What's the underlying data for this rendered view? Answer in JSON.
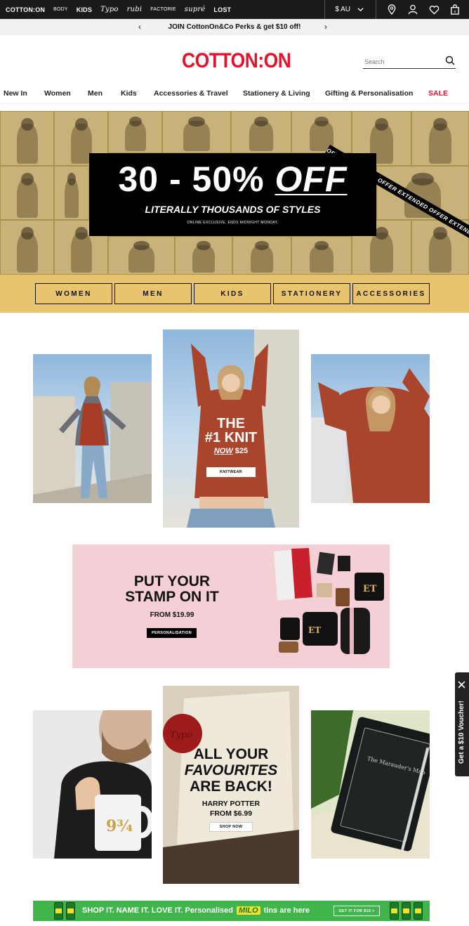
{
  "brandbar": {
    "brands": [
      "COTTON:ON",
      "BODY",
      "KIDS",
      "Typo",
      "rubi",
      "FACTORIE",
      "supré",
      "LOST"
    ],
    "currency": "$ AU",
    "icons": [
      "location-icon",
      "account-icon",
      "wishlist-icon",
      "bag-icon"
    ]
  },
  "promo": {
    "text": "JOIN CottonOn&Co Perks & get $10 off!"
  },
  "header": {
    "logo": "COTTON:ON",
    "search_placeholder": "Search"
  },
  "nav": {
    "items": [
      "New In",
      "Women",
      "Men",
      "Kids",
      "Accessories & Travel",
      "Stationery & Living",
      "Gifting & Personalisation",
      "SALE"
    ]
  },
  "hero": {
    "headline": "30 - 50%",
    "headline_em": "OFF",
    "subhead": "LITERALLY THOUSANDS OF STYLES",
    "fine": "ONLINE EXCLUSIVE. ENDS MIDNIGHT MONDAY.",
    "ribbon": "OFFER EXTENDED   OFFER EXTENDED   OFFER EXTENDED   OFFER EXTENDED",
    "categories": [
      "WOMEN",
      "MEN",
      "KIDS",
      "STATIONERY",
      "ACCESSORIES"
    ]
  },
  "knit": {
    "title_l1": "THE",
    "title_l2": "#1 KNIT",
    "now": "NOW",
    "price": "$25",
    "button": "KNITWEAR"
  },
  "stamp": {
    "title": "PUT YOUR STAMP ON IT",
    "from": "FROM $19.99",
    "button": "PERSONALISATION"
  },
  "hp": {
    "l1": "ALL YOUR",
    "l2": "FAVOURITES",
    "l3": "ARE BACK!",
    "brand": "HARRY POTTER",
    "from": "FROM $6.99",
    "button": "SHOP NOW",
    "stamp_text": "Typo",
    "map_text": "The Marauder's Map"
  },
  "milo": {
    "text": "SHOP IT. NAME IT. LOVE IT.  Personalised",
    "brand": "MILO",
    "text2": "tins are here",
    "button": "GET IT FOR $10 >"
  },
  "voucher": {
    "text": "Get a $10 Voucher!"
  },
  "colors": {
    "brand_red": "#e3122d",
    "hero_gold": "#e8c46f",
    "stamp_pink": "#f5cfd6",
    "milo_green": "#3fb54b"
  }
}
